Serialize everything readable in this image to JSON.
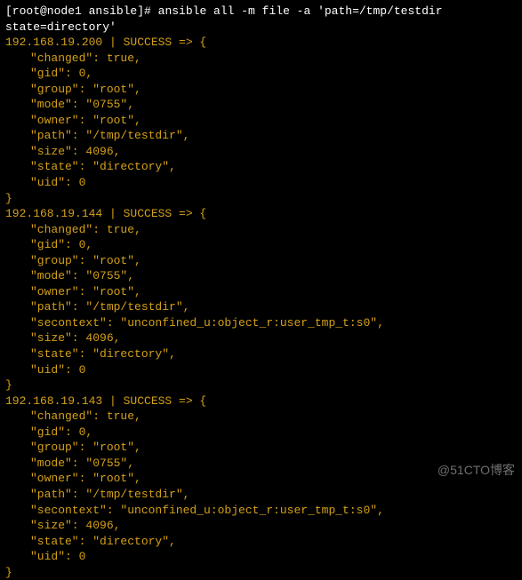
{
  "prompt": {
    "user": "root",
    "host": "node1",
    "cwd": "ansible",
    "symbol": "#",
    "command": "ansible all -m file -a 'path=/tmp/testdir state=directory'"
  },
  "results": [
    {
      "ip": "192.168.19.200",
      "status": "SUCCESS",
      "arrow": "=>",
      "fields": [
        {
          "k": "changed",
          "v": "true",
          "t": "bool"
        },
        {
          "k": "gid",
          "v": "0",
          "t": "num"
        },
        {
          "k": "group",
          "v": "root",
          "t": "str"
        },
        {
          "k": "mode",
          "v": "0755",
          "t": "str"
        },
        {
          "k": "owner",
          "v": "root",
          "t": "str"
        },
        {
          "k": "path",
          "v": "/tmp/testdir",
          "t": "str"
        },
        {
          "k": "size",
          "v": "4096",
          "t": "num"
        },
        {
          "k": "state",
          "v": "directory",
          "t": "str"
        },
        {
          "k": "uid",
          "v": "0",
          "t": "num"
        }
      ]
    },
    {
      "ip": "192.168.19.144",
      "status": "SUCCESS",
      "arrow": "=>",
      "fields": [
        {
          "k": "changed",
          "v": "true",
          "t": "bool"
        },
        {
          "k": "gid",
          "v": "0",
          "t": "num"
        },
        {
          "k": "group",
          "v": "root",
          "t": "str"
        },
        {
          "k": "mode",
          "v": "0755",
          "t": "str"
        },
        {
          "k": "owner",
          "v": "root",
          "t": "str"
        },
        {
          "k": "path",
          "v": "/tmp/testdir",
          "t": "str"
        },
        {
          "k": "secontext",
          "v": "unconfined_u:object_r:user_tmp_t:s0",
          "t": "str"
        },
        {
          "k": "size",
          "v": "4096",
          "t": "num"
        },
        {
          "k": "state",
          "v": "directory",
          "t": "str"
        },
        {
          "k": "uid",
          "v": "0",
          "t": "num"
        }
      ]
    },
    {
      "ip": "192.168.19.143",
      "status": "SUCCESS",
      "arrow": "=>",
      "fields": [
        {
          "k": "changed",
          "v": "true",
          "t": "bool"
        },
        {
          "k": "gid",
          "v": "0",
          "t": "num"
        },
        {
          "k": "group",
          "v": "root",
          "t": "str"
        },
        {
          "k": "mode",
          "v": "0755",
          "t": "str"
        },
        {
          "k": "owner",
          "v": "root",
          "t": "str"
        },
        {
          "k": "path",
          "v": "/tmp/testdir",
          "t": "str"
        },
        {
          "k": "secontext",
          "v": "unconfined_u:object_r:user_tmp_t:s0",
          "t": "str"
        },
        {
          "k": "size",
          "v": "4096",
          "t": "num"
        },
        {
          "k": "state",
          "v": "directory",
          "t": "str"
        },
        {
          "k": "uid",
          "v": "0",
          "t": "num"
        }
      ]
    }
  ],
  "watermark": "@51CTO博客"
}
